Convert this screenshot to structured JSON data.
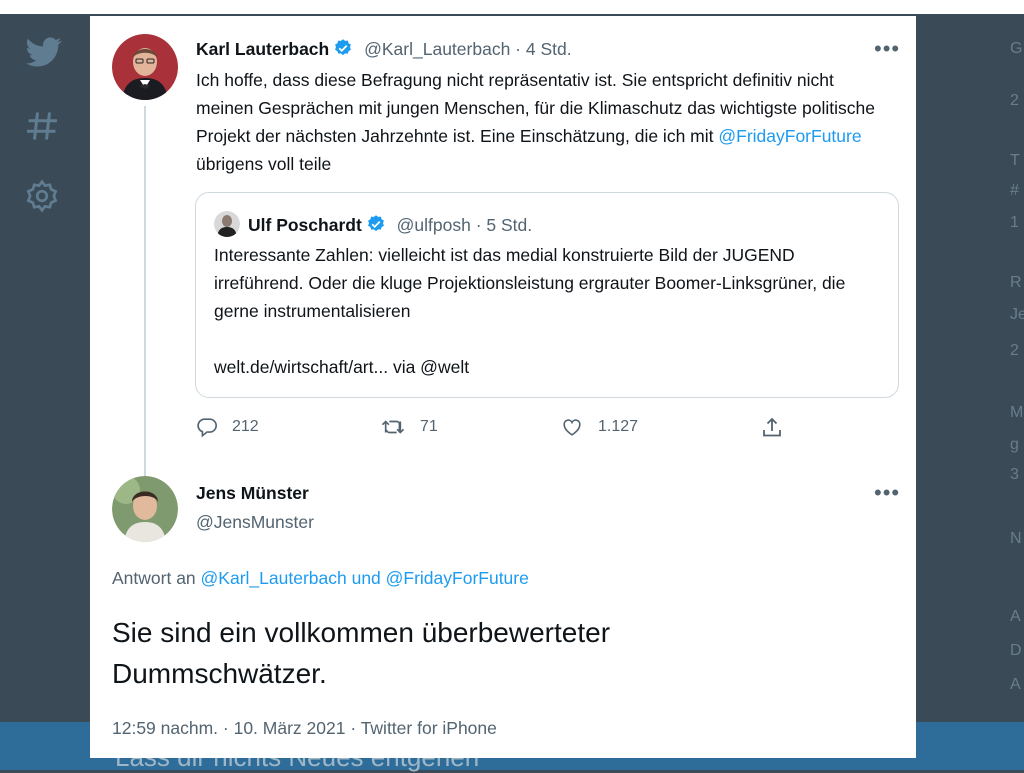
{
  "background": {
    "footer_text": "Lass dir nichts Neues entgehen",
    "right_letters": [
      "G",
      "2",
      "T",
      "#",
      "1",
      "R",
      "Je",
      "2",
      "M",
      "g",
      "3",
      "N",
      "A",
      "D",
      "A"
    ]
  },
  "tweet": {
    "author_name": "Karl Lauterbach",
    "handle_time": "@Karl_Lauterbach · 4 Std.",
    "text_before": "Ich hoffe, dass diese Befragung nicht repräsentativ ist. Sie entspricht definitiv nicht meinen Gesprächen mit jungen Menschen, für die Klimaschutz das wichtigste politische Projekt der nächsten Jahrzehnte ist. Eine Einschätzung, die ich mit ",
    "mention": "@FridayForFuture",
    "text_after": " übrigens voll teile",
    "quoted": {
      "author_name": "Ulf Poschardt",
      "handle_time": "@ulfposh · 5 Std.",
      "text": "Interessante Zahlen: vielleicht ist das medial konstruierte Bild der JUGEND irreführend. Oder die kluge Projektionsleistung ergrauter Boomer-Linksgrüner, die gerne instrumentalisieren",
      "link_text": "welt.de/wirtschaft/art... via @welt"
    },
    "replies": "212",
    "retweets": "71",
    "likes": "1.127"
  },
  "reply": {
    "author_name": "Jens Münster",
    "handle": "@JensMunster",
    "reply_to_label": "Antwort an",
    "reply_to_mentions": "@Karl_Lauterbach und @FridayForFuture",
    "text": "Sie sind ein vollkommen überbewerteter Dummschwätzer.",
    "meta": "12:59 nachm. · 10. März 2021 · Twitter for iPhone"
  },
  "colors": {
    "accent": "#1d9bf0",
    "text": "#0f1419",
    "muted": "#536471"
  },
  "icons": [
    "twitter-logo-icon",
    "hashtag-icon",
    "gear-icon",
    "verified-badge-icon",
    "more-icon",
    "reply-icon",
    "retweet-icon",
    "like-icon",
    "share-icon"
  ]
}
